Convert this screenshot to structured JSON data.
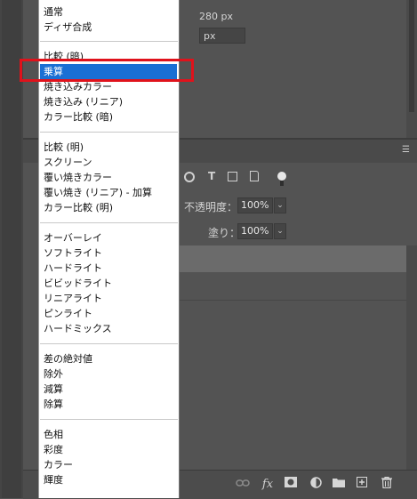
{
  "properties": {
    "size_text": "280 px",
    "field_text": "px"
  },
  "layers": {
    "opacity_label": "不透明度：",
    "opacity_value": "100%",
    "fill_label": "塗り：",
    "fill_value": "100%"
  },
  "blend_menu": {
    "groups": [
      [
        "通常",
        "ディザ合成"
      ],
      [
        "比較 (暗)",
        "乗算",
        "焼き込みカラー",
        "焼き込み (リニア)",
        "カラー比較 (暗)"
      ],
      [
        "比較 (明)",
        "スクリーン",
        "覆い焼きカラー",
        "覆い焼き (リニア) - 加算",
        "カラー比較 (明)"
      ],
      [
        "オーバーレイ",
        "ソフトライト",
        "ハードライト",
        "ビビッドライト",
        "リニアライト",
        "ピンライト",
        "ハードミックス"
      ],
      [
        "差の絶対値",
        "除外",
        "減算",
        "除算"
      ],
      [
        "色相",
        "彩度",
        "カラー",
        "輝度"
      ]
    ],
    "selected": "乗算"
  },
  "colors": {
    "selection": "#1a6fd4",
    "annotation": "#e0121b",
    "panel_bg": "#535353"
  },
  "icons": {
    "filter_type": "T",
    "filter_shape": "shape-icon",
    "filter_smart": "smart-object-icon",
    "bottom": [
      "link-icon",
      "fx-icon",
      "mask-icon",
      "adjustment-icon",
      "folder-icon",
      "new-layer-icon",
      "trash-icon"
    ]
  }
}
